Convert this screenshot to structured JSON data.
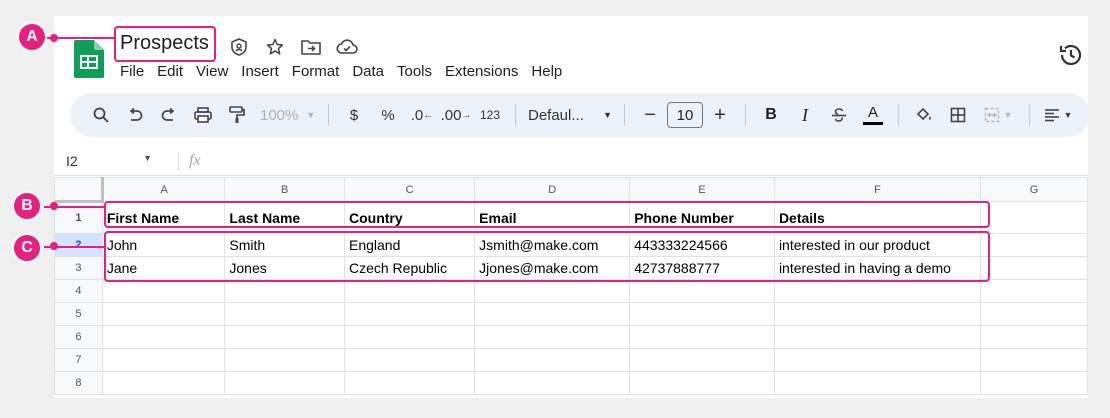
{
  "document": {
    "title": "Prospects"
  },
  "menu": [
    "File",
    "Edit",
    "View",
    "Insert",
    "Format",
    "Data",
    "Tools",
    "Extensions",
    "Help"
  ],
  "toolbar": {
    "zoom": "100%",
    "currency": "$",
    "percent": "%",
    "decrease_decimal": ".0",
    "increase_decimal": ".00",
    "number_format": "123",
    "font": "Defaul...",
    "font_size": "10",
    "bold": "B",
    "italic": "I",
    "text_color": "A"
  },
  "formula_bar": {
    "cell_ref": "I2",
    "fx": "fx"
  },
  "sheet": {
    "columns": [
      "A",
      "B",
      "C",
      "D",
      "E",
      "F",
      "G"
    ],
    "rows": [
      {
        "num": "1",
        "cells": [
          "First Name",
          "Last Name",
          "Country",
          "Email",
          "Phone Number",
          "Details",
          ""
        ]
      },
      {
        "num": "2",
        "cells": [
          "John",
          "Smith",
          "England",
          "Jsmith@make.com",
          "443333224566",
          "interested in our product",
          ""
        ]
      },
      {
        "num": "3",
        "cells": [
          "Jane",
          "Jones",
          "Czech Republic",
          "Jjones@make.com",
          "42737888777",
          "interested in having a demo",
          ""
        ]
      },
      {
        "num": "4",
        "cells": [
          "",
          "",
          "",
          "",
          "",
          "",
          ""
        ]
      },
      {
        "num": "5",
        "cells": [
          "",
          "",
          "",
          "",
          "",
          "",
          ""
        ]
      },
      {
        "num": "6",
        "cells": [
          "",
          "",
          "",
          "",
          "",
          "",
          ""
        ]
      },
      {
        "num": "7",
        "cells": [
          "",
          "",
          "",
          "",
          "",
          "",
          ""
        ]
      },
      {
        "num": "8",
        "cells": [
          "",
          "",
          "",
          "",
          "",
          "",
          ""
        ]
      }
    ]
  },
  "annotations": [
    "A",
    "B",
    "C"
  ],
  "colors": {
    "accent": "#e6207d",
    "sheets_green": "#0f9d58",
    "toolbar_bg": "#edf2fa"
  }
}
